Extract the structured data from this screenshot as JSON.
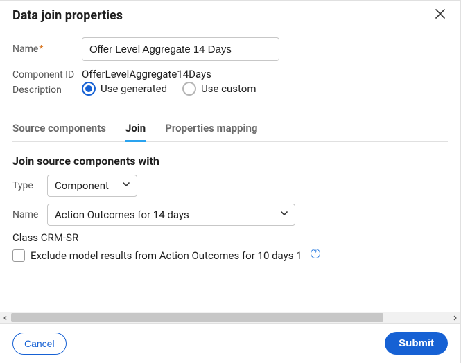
{
  "header": {
    "title": "Data join properties"
  },
  "form": {
    "name_label": "Name",
    "name_value": "Offer Level Aggregate 14 Days",
    "component_id_label": "Component ID",
    "component_id_value": "OfferLevelAggregate14Days",
    "description_label": "Description",
    "radio_generated": "Use generated",
    "radio_custom": "Use custom"
  },
  "tabs": {
    "source": "Source components",
    "join": "Join",
    "mapping": "Properties mapping"
  },
  "join": {
    "section_title": "Join source components with",
    "type_label": "Type",
    "type_value": "Component",
    "name_label": "Name",
    "name_value": "Action Outcomes for 14 days",
    "class_label": "Class",
    "class_value": "CRM-SR",
    "exclude_label": "Exclude model results from Action Outcomes for 10 days 1"
  },
  "footer": {
    "cancel": "Cancel",
    "submit": "Submit"
  }
}
